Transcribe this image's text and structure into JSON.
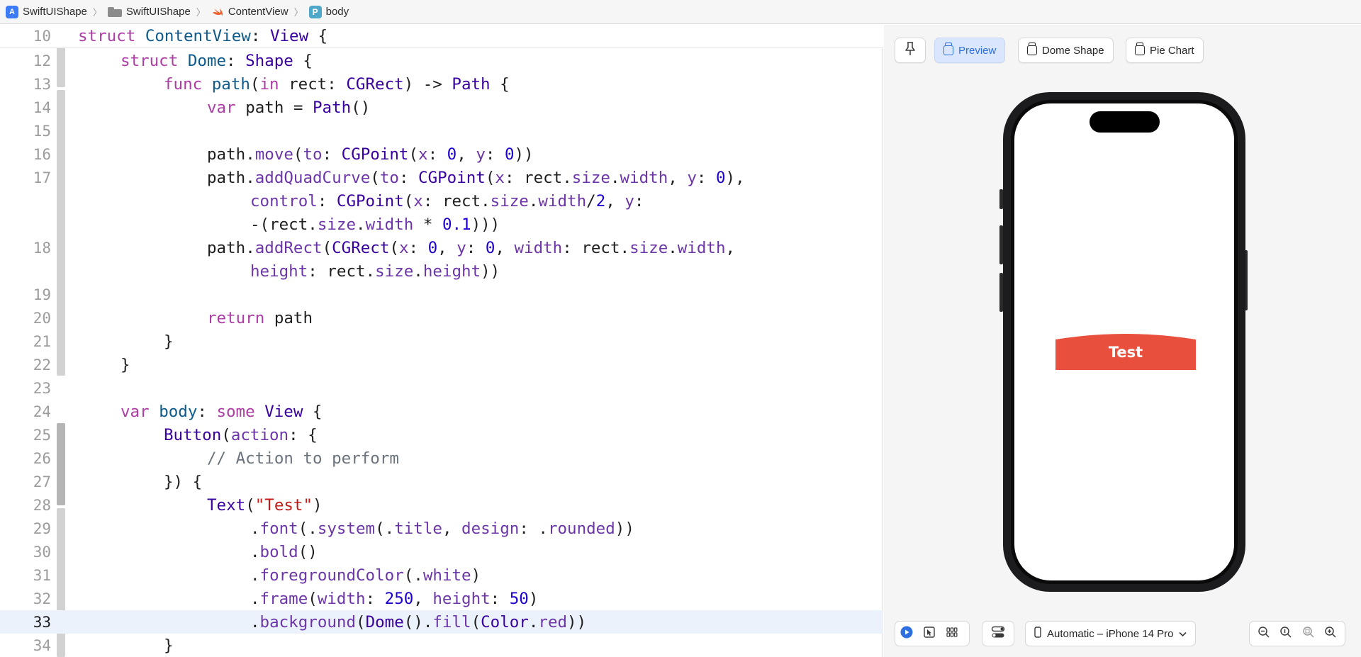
{
  "breadcrumb": {
    "items": [
      {
        "label": "SwiftUIShape",
        "icon": "xcode-project-icon"
      },
      {
        "label": "SwiftUIShape",
        "icon": "folder-icon"
      },
      {
        "label": "ContentView",
        "icon": "swift-file-icon"
      },
      {
        "label": "body",
        "icon": "property-icon"
      }
    ],
    "separator": "〉"
  },
  "editor": {
    "sticky_line": {
      "number": "10"
    },
    "lines": [
      {
        "number": "12"
      },
      {
        "number": "13"
      },
      {
        "number": "14"
      },
      {
        "number": "15"
      },
      {
        "number": "16"
      },
      {
        "number": "17"
      },
      {
        "number": ""
      },
      {
        "number": ""
      },
      {
        "number": "18"
      },
      {
        "number": ""
      },
      {
        "number": "19"
      },
      {
        "number": "20"
      },
      {
        "number": "21"
      },
      {
        "number": "22"
      },
      {
        "number": "23"
      },
      {
        "number": "24"
      },
      {
        "number": "25"
      },
      {
        "number": "26"
      },
      {
        "number": "27"
      },
      {
        "number": "28"
      },
      {
        "number": "29"
      },
      {
        "number": "30"
      },
      {
        "number": "31"
      },
      {
        "number": "32"
      },
      {
        "number": "33"
      },
      {
        "number": "34"
      }
    ],
    "current_line": "33",
    "tokens": {
      "struct": "struct",
      "ContentView": "ContentView",
      "View": "View",
      "Dome": "Dome",
      "Shape": "Shape",
      "func": "func",
      "path": "path",
      "in": "in",
      "rect": "rect",
      "CGRect": "CGRect",
      "Path": "Path",
      "var": "var",
      "move": "move",
      "to": "to",
      "CGPoint": "CGPoint",
      "x": "x",
      "y": "y",
      "zero": "0",
      "addQuadCurve": "addQuadCurve",
      "size": "size",
      "width": "width",
      "control": "control",
      "two": "2",
      "pointone": "0.1",
      "addRect": "addRect",
      "height": "height",
      "return": "return",
      "body": "body",
      "some": "some",
      "Button": "Button",
      "action": "action",
      "comment": "// Action to perform",
      "Text": "Text",
      "test_str": "\"Test\"",
      "font": "font",
      "system": "system",
      "title": "title",
      "design": "design",
      "rounded": "rounded",
      "bold": "bold",
      "foregroundColor": "foregroundColor",
      "white": "white",
      "frame": "frame",
      "w250": "250",
      "h50": "50",
      "background": "background",
      "fill": "fill",
      "Color": "Color",
      "red": "red"
    }
  },
  "preview": {
    "pin_icon": "pin-icon",
    "tabs": [
      {
        "label": "Preview",
        "active": true
      },
      {
        "label": "Dome Shape",
        "active": false
      },
      {
        "label": "Pie Chart",
        "active": false
      }
    ],
    "button_label": "Test",
    "button_color": "#e94f3d",
    "device": "Automatic – iPhone 14 Pro",
    "accent": "#2f6fe0"
  }
}
